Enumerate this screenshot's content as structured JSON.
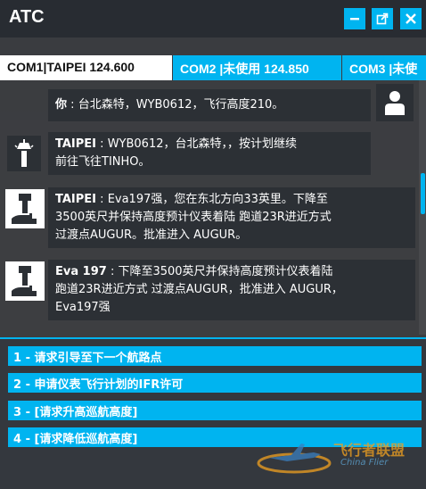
{
  "window": {
    "title": "ATC",
    "accent": "#00b4f0",
    "controls": [
      "minimize-icon",
      "popout-icon",
      "close-icon"
    ]
  },
  "tabs": [
    {
      "name": "COM1",
      "sep": "|",
      "station": "TAIPEI",
      "freq": "124.600",
      "active": true
    },
    {
      "name": "COM2",
      "sep": "|",
      "station": "未使用",
      "freq": "124.850",
      "active": false
    },
    {
      "name": "COM3",
      "sep": "|",
      "station": "未使",
      "freq": "",
      "active": false
    }
  ],
  "messages": [
    {
      "speaker": "你",
      "sep": ":",
      "text": "台北森特，WYB0612，飞行高度210。",
      "icon": "pilot-icon"
    },
    {
      "speaker": "TAIPEI",
      "sep": ":",
      "lines": [
        "WYB0612，台北森特，，按计划继续",
        "前往飞往TINHO。"
      ],
      "icon": "tower-icon"
    },
    {
      "speaker": "TAIPEI",
      "sep": ":",
      "lines": [
        "Eva197强，您在东北方向33英里。下降至",
        "3500英尺并保持高度预计仪表着陆 跑道23R进近方式",
        "过渡点AUGUR。批准进入 AUGUR。"
      ],
      "icon": "tower-icon"
    },
    {
      "speaker": "Eva 197",
      "sep": ":",
      "lines": [
        "下降至3500英尺并保持高度预计仪表着陆",
        "跑道23R进近方式 过渡点AUGUR，批准进入 AUGUR，",
        "Eva197强"
      ],
      "icon": "tower-icon"
    }
  ],
  "options": [
    "1 - 请求引导至下一个航路点",
    "2 - 申请仪表飞行计划的IFR许可",
    "3 - [请求升高巡航高度]",
    "4 - [请求降低巡航高度]"
  ],
  "watermark": {
    "text1": "飞行者联盟",
    "text2": "China Flier"
  }
}
